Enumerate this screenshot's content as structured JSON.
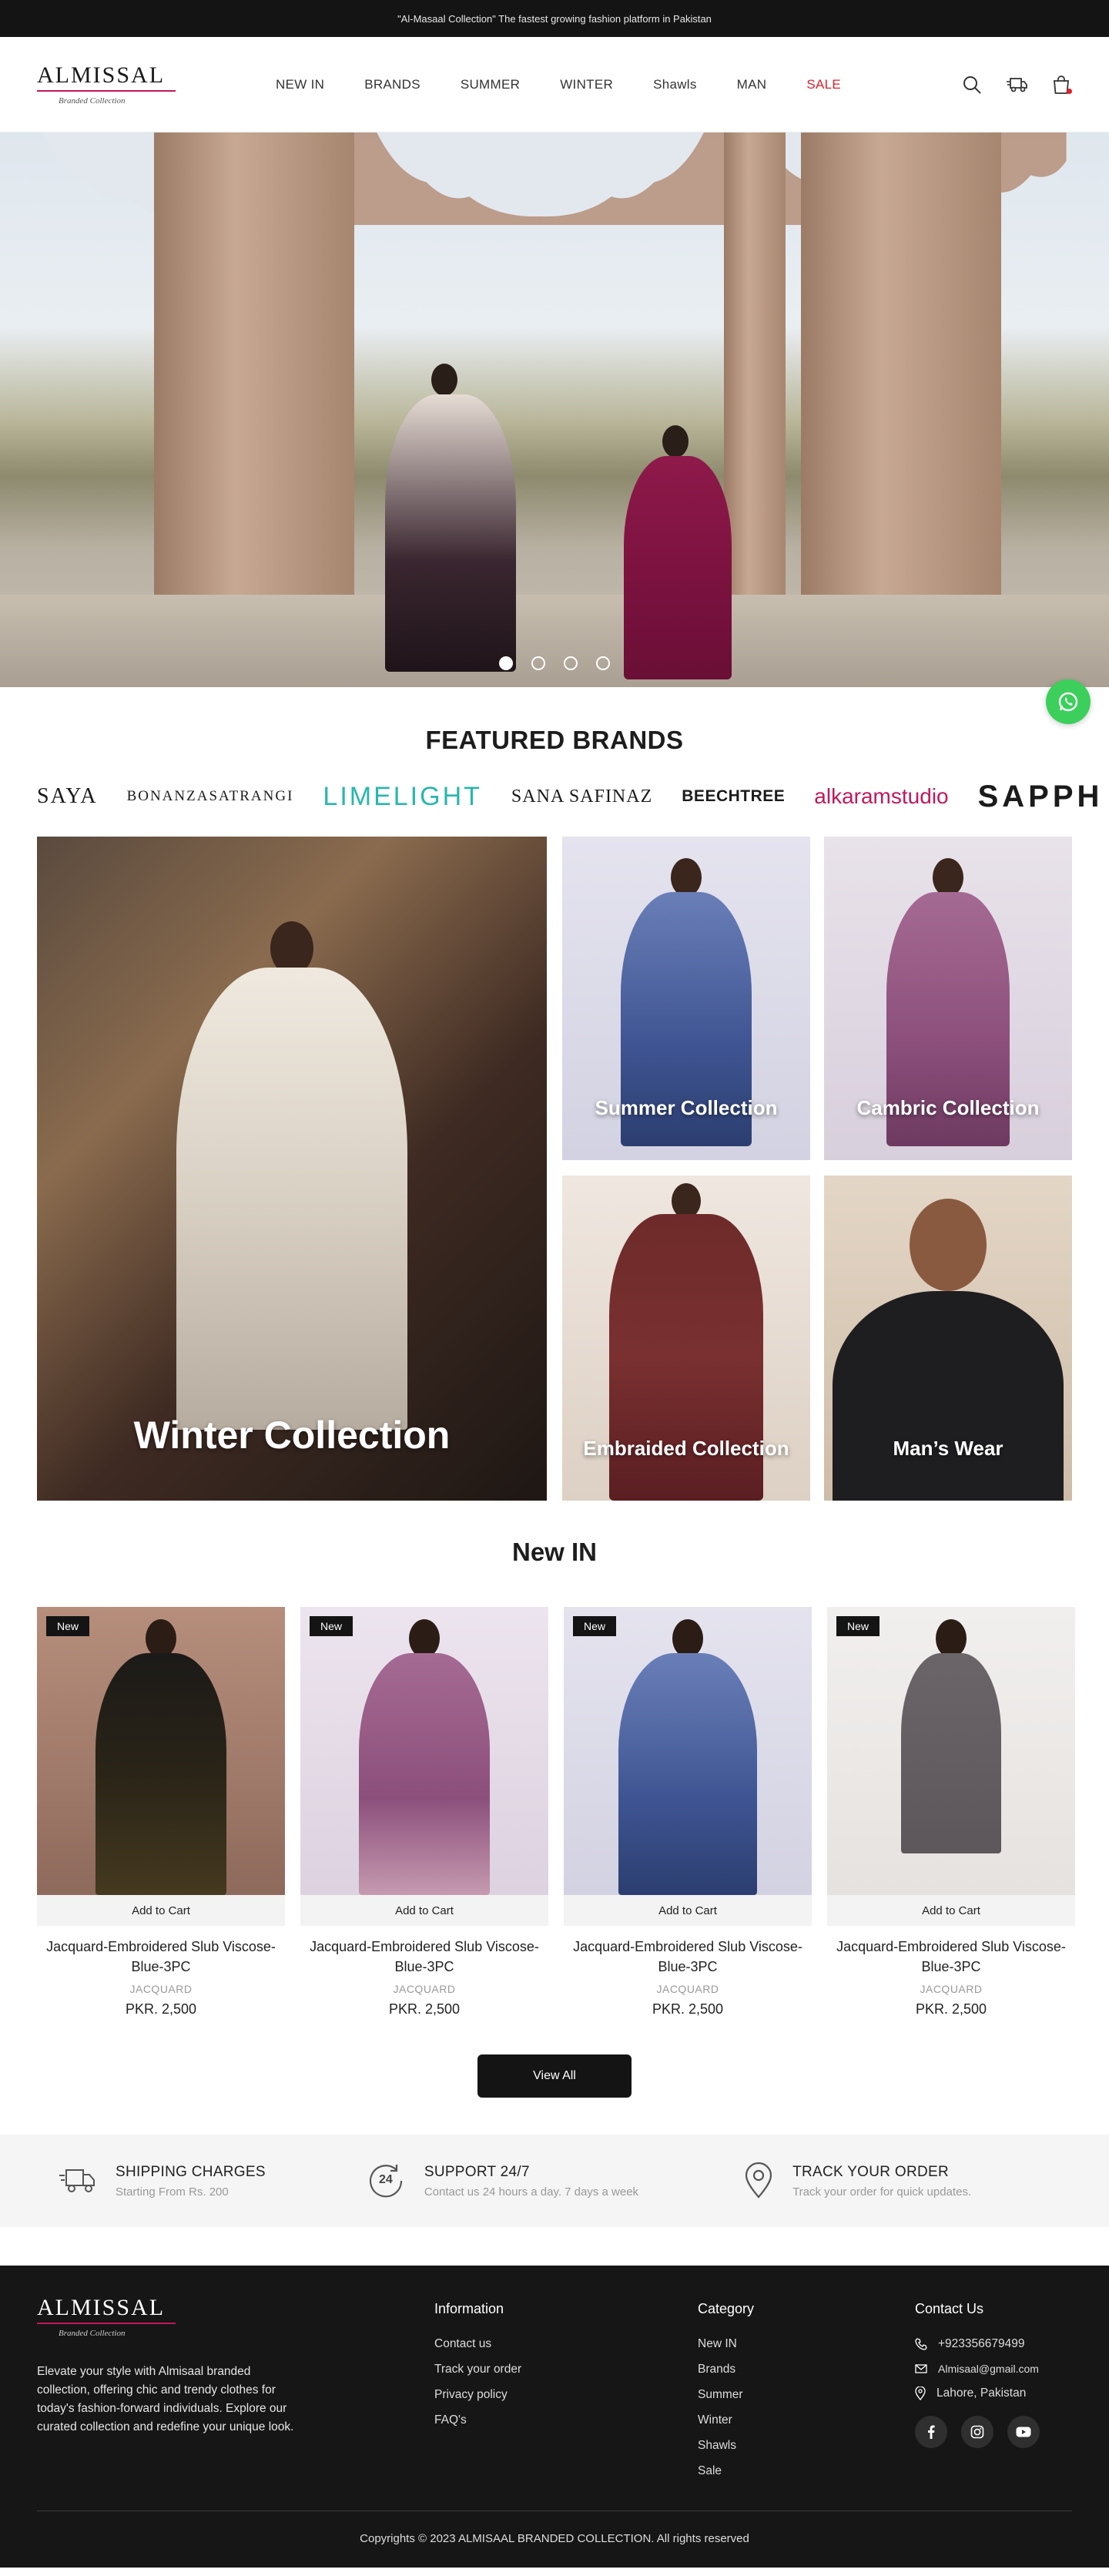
{
  "announcement": "\"Al-Masaal Collection\" The fastest growing fashion platform in Pakistan",
  "logo": {
    "name": "ALMISSAL",
    "tagline": "Branded Collection"
  },
  "nav": [
    {
      "label": "NEW IN"
    },
    {
      "label": "BRANDS"
    },
    {
      "label": "SUMMER"
    },
    {
      "label": "WINTER"
    },
    {
      "label": "Shawls"
    },
    {
      "label": "MAN"
    },
    {
      "label": "SALE"
    }
  ],
  "header_icons": [
    "search-icon",
    "truck-icon",
    "shopping-bag-icon"
  ],
  "colors": {
    "accent": "#e11d2c",
    "brand_pink": "#c2185b",
    "dark": "#141414",
    "whatsapp": "#3ccf5c"
  },
  "hero": {
    "slides": 4,
    "active_slide": 1
  },
  "featured_brands": {
    "title": "FEATURED BRANDS",
    "brands": [
      "SAYA",
      "BONANZA",
      "SATRANGI",
      "LIMELIGHT",
      "SANA SAFINAZ",
      "BEECHTREE",
      "alkaram",
      "studio",
      "SAPPH"
    ]
  },
  "collections": [
    {
      "label": "Winter Collection"
    },
    {
      "label": "Summer Collection"
    },
    {
      "label": "Cambric Collection"
    },
    {
      "label": "Embraided Collection"
    },
    {
      "label": "Man’s Wear"
    }
  ],
  "new_in": {
    "title": "New IN",
    "badge": "New",
    "add_to_cart": "Add to Cart",
    "products": [
      {
        "name": "Jacquard-Embroidered Slub Viscose-Blue-3PC",
        "category": "JACQUARD",
        "price": "PKR. 2,500"
      },
      {
        "name": "Jacquard-Embroidered Slub Viscose-Blue-3PC",
        "category": "JACQUARD",
        "price": "PKR. 2,500"
      },
      {
        "name": "Jacquard-Embroidered Slub Viscose-Blue-3PC",
        "category": "JACQUARD",
        "price": "PKR. 2,500"
      },
      {
        "name": "Jacquard-Embroidered Slub Viscose-Blue-3PC",
        "category": "JACQUARD",
        "price": "PKR. 2,500"
      }
    ],
    "view_all": "View All"
  },
  "features": [
    {
      "title": "SHIPPING CHARGES",
      "subtitle": "Starting From Rs. 200"
    },
    {
      "title": "SUPPORT 24/7",
      "subtitle": "Contact us 24 hours a day. 7 days a week",
      "icon_text": "24"
    },
    {
      "title": "TRACK  YOUR ORDER",
      "subtitle": "Track your order for quick updates."
    }
  ],
  "footer": {
    "about": "Elevate your style with Almisaal branded collection, offering chic and trendy clothes for today's fashion-forward individuals. Explore our curated collection and redefine your unique look.",
    "information": {
      "title": "Information",
      "links": [
        "Contact us",
        "Track your order",
        "Privacy policy",
        "FAQ's"
      ]
    },
    "category": {
      "title": "Category",
      "links": [
        "New IN",
        "Brands",
        "Summer",
        "Winter",
        "Shawls",
        "Sale"
      ]
    },
    "contact": {
      "title": "Contact Us",
      "phone": "+923356679499",
      "email": "Almisaal@gmail.com",
      "address": "Lahore, Pakistan"
    },
    "copyright": "Copyrights © 2023 ALMISAAL BRANDED COLLECTION. All rights reserved"
  }
}
